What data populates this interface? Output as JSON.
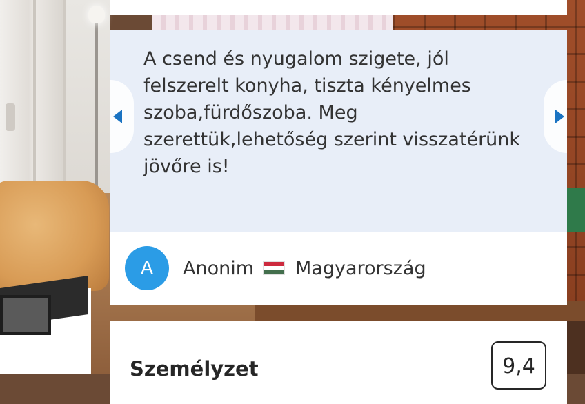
{
  "review": {
    "text": "A csend és nyugalom szigete, jól felszerelt konyha, tiszta kényelmes szoba,fürdőszoba. Meg szerettük,lehetőség szerint visszatérünk jövőre is!",
    "reviewer": {
      "avatar_letter": "A",
      "name": "Anonim",
      "country": "Magyarország",
      "flag_icon": "hungary-flag-icon",
      "flag_colors": [
        "#cd2a3e",
        "#ffffff",
        "#436f4d"
      ]
    },
    "prev_icon": "chevron-left-icon",
    "next_icon": "chevron-right-icon"
  },
  "category": {
    "label": "Személyzet",
    "score": "9,4"
  },
  "colors": {
    "accent": "#1a73c2",
    "avatar_bg": "#2b9ce6",
    "quote_bg": "#e8eef8"
  }
}
